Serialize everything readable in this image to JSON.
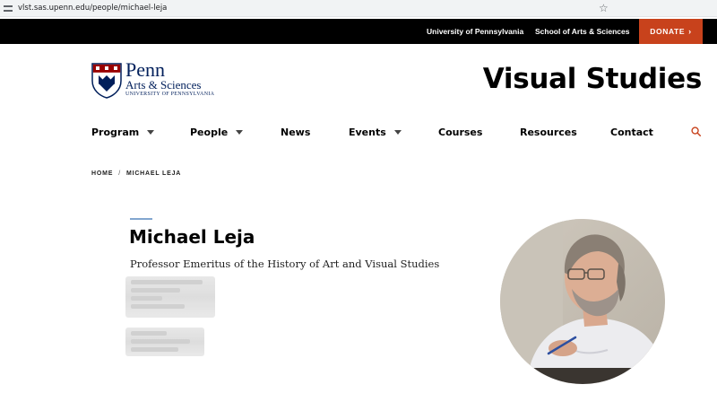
{
  "browser": {
    "url": "vlst.sas.upenn.edu/people/michael-leja"
  },
  "topbar": {
    "university_link": "University of Pennsylvania",
    "school_link": "School of Arts & Sciences",
    "donate_label": "DONATE"
  },
  "logo": {
    "line1": "Penn",
    "line2": "Arts & Sciences",
    "line3": "University of Pennsylvania"
  },
  "site_title": "Visual Studies",
  "nav": {
    "items": [
      {
        "label": "Program"
      },
      {
        "label": "People"
      },
      {
        "label": "News"
      },
      {
        "label": "Events"
      },
      {
        "label": "Courses"
      },
      {
        "label": "Resources"
      },
      {
        "label": "Contact"
      }
    ]
  },
  "breadcrumb": {
    "home": "HOME",
    "separator": "/",
    "current": "MICHAEL LEJA"
  },
  "person": {
    "name": "Michael Leja",
    "title": "Professor Emeritus of the History of Art and Visual Studies"
  },
  "colors": {
    "accent": "#c8421c",
    "brand_navy": "#011f5b",
    "name_rule": "#82a6cf"
  }
}
